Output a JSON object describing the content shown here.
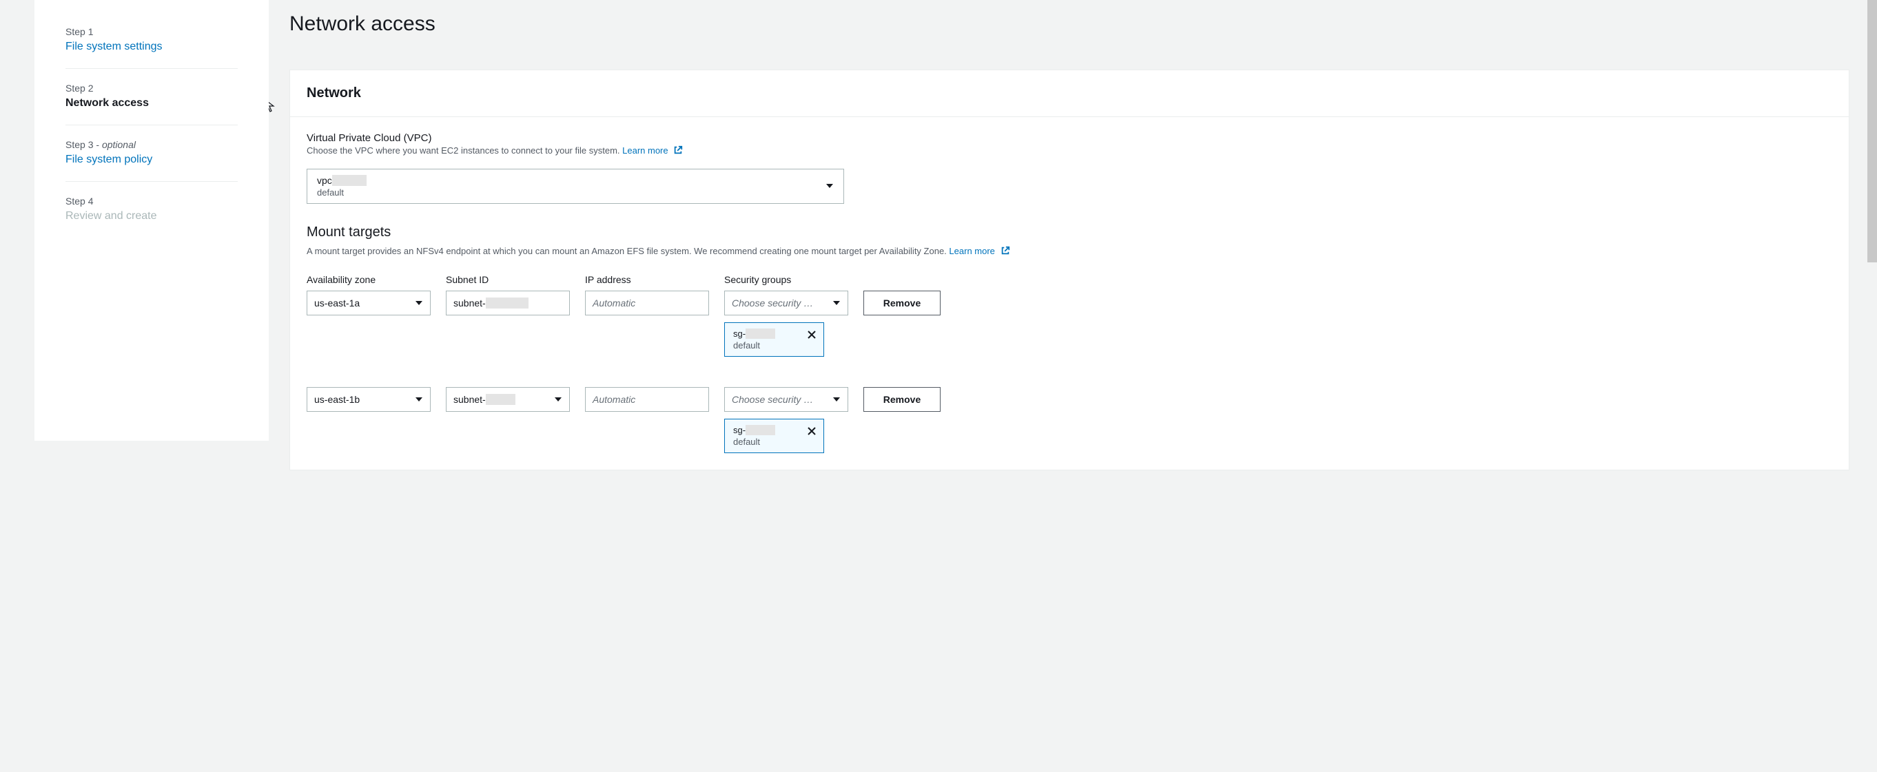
{
  "sidebar": {
    "steps": [
      {
        "number": "Step 1",
        "title": "File system settings"
      },
      {
        "number": "Step 2",
        "title": "Network access"
      },
      {
        "number": "Step 3",
        "optional": "optional",
        "title": "File system policy"
      },
      {
        "number": "Step 4",
        "title": "Review and create"
      }
    ]
  },
  "page": {
    "title": "Network access"
  },
  "network": {
    "panel_title": "Network",
    "vpc_label": "Virtual Private Cloud (VPC)",
    "vpc_desc": "Choose the VPC where you want EC2 instances to connect to your file system.",
    "learn_more": "Learn more",
    "vpc_value": "vpc",
    "vpc_subtitle": "default"
  },
  "mount": {
    "title": "Mount targets",
    "desc": "A mount target provides an NFSv4 endpoint at which you can mount an Amazon EFS file system. We recommend creating one mount target per Availability Zone.",
    "learn_more": "Learn more",
    "headers": {
      "az": "Availability zone",
      "subnet": "Subnet ID",
      "ip": "IP address",
      "sg": "Security groups"
    },
    "sg_placeholder": "Choose security …",
    "ip_placeholder": "Automatic",
    "remove_label": "Remove",
    "rows": [
      {
        "az": "us-east-1a",
        "subnet_prefix": "subnet-",
        "sg": {
          "id": "sg-",
          "name": "default"
        }
      },
      {
        "az": "us-east-1b",
        "subnet_prefix": "subnet-",
        "sg": {
          "id": "sg-",
          "name": "default"
        }
      }
    ]
  }
}
